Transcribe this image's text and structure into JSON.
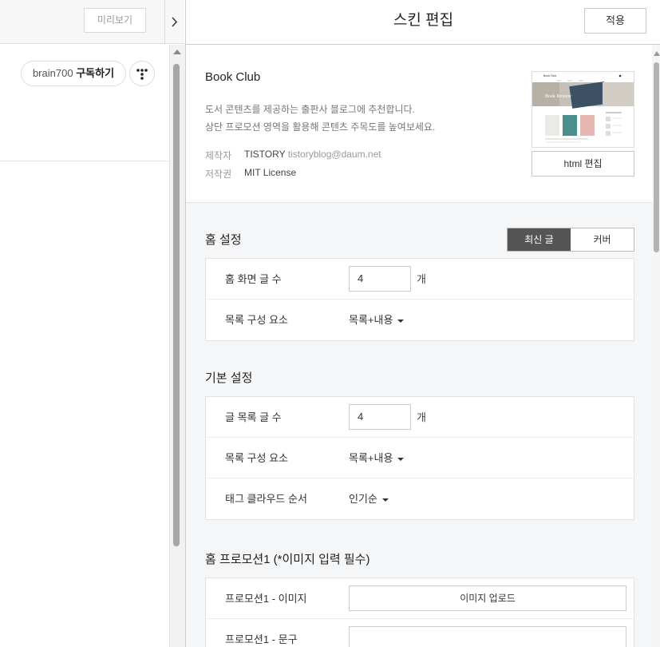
{
  "left_pane": {
    "preview_label": "미리보기",
    "subscribe": {
      "blog": "brain700",
      "action": "구독하기"
    },
    "more_icon": "dots-grid-icon",
    "collapse_icon": "chevron-right-icon"
  },
  "editor": {
    "title": "스킨 편집",
    "apply_label": "적용",
    "skin": {
      "name": "Book Club",
      "desc_line1": "도서 콘텐츠를 제공하는 출판사 블로그에 추천합니다.",
      "desc_line2": "상단 프로모션 영역을 활용해 콘텐츠 주목도를 높여보세요.",
      "maker_label": "제작자",
      "maker_name": "TISTORY",
      "maker_email": "tistoryblog@daum.net",
      "license_label": "저작권",
      "license_value": "MIT License",
      "thumb_site_title": "Book Club",
      "thumb_banner_text": "Book Review",
      "html_edit_label": "html 편집"
    },
    "home_settings": {
      "title": "홈 설정",
      "mode_latest": "최신 글",
      "mode_cover": "커버",
      "rows": [
        {
          "label": "홈 화면 글 수",
          "value": "4",
          "unit": "개"
        },
        {
          "label": "목록 구성 요소",
          "value": "목록+내용"
        }
      ]
    },
    "basic_settings": {
      "title": "기본 설정",
      "rows": [
        {
          "label": "글 목록 글 수",
          "value": "4",
          "unit": "개"
        },
        {
          "label": "목록 구성 요소",
          "value": "목록+내용"
        },
        {
          "label": "태그 클라우드 순서",
          "value": "인기순"
        }
      ]
    },
    "promotion": {
      "title": "홈 프로모션1 (*이미지 입력 필수)",
      "rows": [
        {
          "label": "프로모션1 - 이미지",
          "button": "이미지 업로드"
        },
        {
          "label": "프로모션1 - 문구",
          "value": ""
        }
      ]
    }
  },
  "colors": {
    "toggle_active_bg": "#555555",
    "settings_bg": "#f5f6f8"
  }
}
